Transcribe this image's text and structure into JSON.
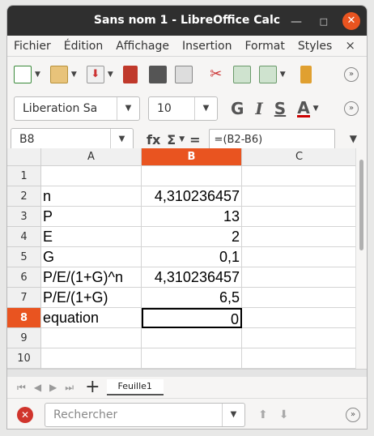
{
  "window": {
    "title": "Sans nom 1 - LibreOffice Calc"
  },
  "menu": {
    "items": [
      "Fichier",
      "Édition",
      "Affichage",
      "Insertion",
      "Format",
      "Styles"
    ],
    "close": "×"
  },
  "format": {
    "font_name": "Liberation Sa",
    "font_size": "10",
    "bold": "G",
    "italic": "I",
    "underline": "S",
    "font_color_label": "A"
  },
  "formula_bar": {
    "cell_ref": "B8",
    "fx": "fx",
    "sigma": "Σ",
    "equals": "=",
    "formula": "=(B2-B6)"
  },
  "sheet": {
    "columns": [
      "A",
      "B",
      "C"
    ],
    "selected_column": "B",
    "selected_row": "8",
    "rows": [
      {
        "num": "1",
        "a": "",
        "b": ""
      },
      {
        "num": "2",
        "a": "n",
        "b": "4,310236457"
      },
      {
        "num": "3",
        "a": "P",
        "b": "13"
      },
      {
        "num": "4",
        "a": "E",
        "b": "2"
      },
      {
        "num": "5",
        "a": "G",
        "b": "0,1"
      },
      {
        "num": "6",
        "a": "P/E/(1+G)^n",
        "b": "4,310236457"
      },
      {
        "num": "7",
        "a": "P/E/(1+G)",
        "b": "6,5"
      },
      {
        "num": "8",
        "a": "equation",
        "b": "0"
      },
      {
        "num": "9",
        "a": "",
        "b": ""
      },
      {
        "num": "10",
        "a": "",
        "b": ""
      }
    ]
  },
  "tabs": {
    "add": "+",
    "sheet_name": "Feuille1"
  },
  "find": {
    "placeholder": "Rechercher"
  },
  "colors": {
    "accent": "#e95420",
    "titlebar": "#2f2f2f"
  }
}
